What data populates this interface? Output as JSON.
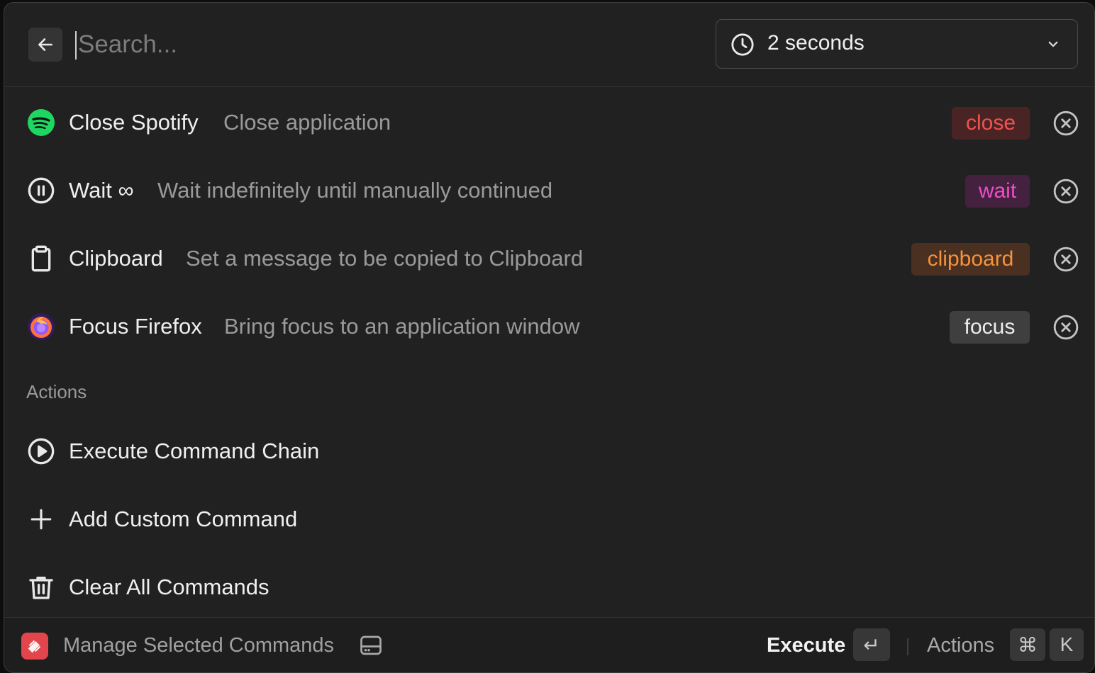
{
  "search": {
    "placeholder": "Search..."
  },
  "delay_dropdown": {
    "selected": "2 seconds"
  },
  "commands": [
    {
      "title": "Close Spotify",
      "subtitle": "Close application",
      "tag": "close",
      "icon": "spotify-icon",
      "tag_color": "#f0534f",
      "tag_bg": "#4a2424"
    },
    {
      "title": "Wait ∞",
      "subtitle": "Wait indefinitely until manually continued",
      "tag": "wait",
      "icon": "pause-circle-icon",
      "tag_color": "#ec4fc7",
      "tag_bg": "#44213f"
    },
    {
      "title": "Clipboard",
      "subtitle": "Set a message to be copied to Clipboard",
      "tag": "clipboard",
      "icon": "clipboard-icon",
      "tag_color": "#f5923e",
      "tag_bg": "#4a3020"
    },
    {
      "title": "Focus Firefox",
      "subtitle": "Bring focus to an application window",
      "tag": "focus",
      "icon": "firefox-icon",
      "tag_color": "#ededed",
      "tag_bg": "#3f3f3f"
    }
  ],
  "actions_section": {
    "label": "Actions",
    "items": [
      {
        "label": "Execute Command Chain",
        "icon": "play-circle-icon"
      },
      {
        "label": "Add Custom Command",
        "icon": "plus-icon"
      },
      {
        "label": "Clear All Commands",
        "icon": "trash-icon"
      }
    ]
  },
  "footer": {
    "title": "Manage Selected Commands",
    "primary_action": "Execute",
    "primary_key": "↵",
    "secondary_action": "Actions",
    "secondary_keys": [
      "⌘",
      "K"
    ]
  }
}
